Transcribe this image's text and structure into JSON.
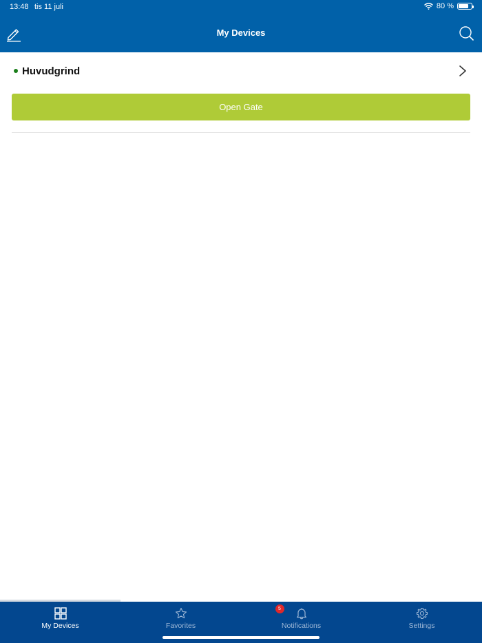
{
  "status_bar": {
    "time": "13:48",
    "date": "tis 11 juli",
    "battery_text": "80 %",
    "battery_level": 0.8
  },
  "nav": {
    "title": "My Devices",
    "edit_icon": "pencil-edit-icon",
    "search_icon": "search-icon"
  },
  "devices": [
    {
      "name": "Huvudgrind",
      "status": "online",
      "status_color": "#1a7e1a",
      "action_label": "Open Gate"
    }
  ],
  "tabs": [
    {
      "label": "My Devices",
      "icon": "grid-icon",
      "active": true
    },
    {
      "label": "Favorites",
      "icon": "star-icon",
      "active": false
    },
    {
      "label": "Notifications",
      "icon": "bell-icon",
      "active": false,
      "badge": "5"
    },
    {
      "label": "Settings",
      "icon": "gear-icon",
      "active": false
    }
  ],
  "colors": {
    "header": "#0161a9",
    "tabbar": "#03478f",
    "action_button": "#afcb37",
    "badge": "#e0282a"
  }
}
